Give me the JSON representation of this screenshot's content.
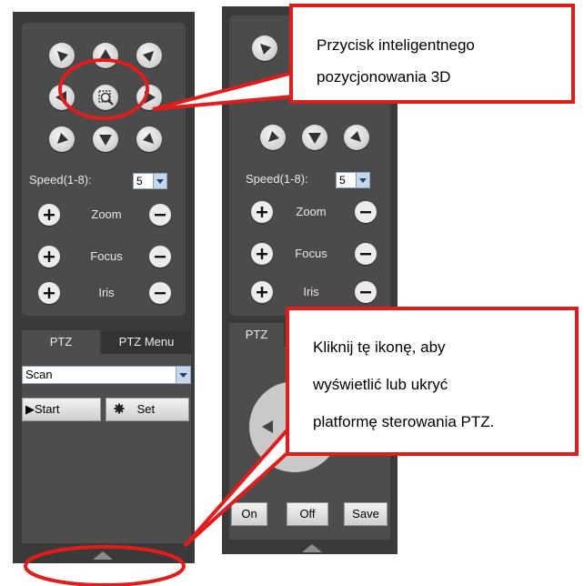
{
  "left_panel": {
    "speed_label": "Speed(1-8):",
    "speed_value": "5",
    "zoom_label": "Zoom",
    "focus_label": "Focus",
    "iris_label": "Iris",
    "tab_ptz": "PTZ",
    "tab_ptz_menu": "PTZ Menu",
    "mode_value": "Scan",
    "start_label": "▶Start",
    "set_label": "Set"
  },
  "right_panel": {
    "speed_label": "Speed(1-8):",
    "speed_value": "5",
    "zoom_label": "Zoom",
    "focus_label": "Focus",
    "iris_label": "Iris",
    "tab_ptz_partial": "PTZ",
    "on_label": "On",
    "off_label": "Off",
    "save_label": "Save"
  },
  "callouts": {
    "top_line1": "Przycisk inteligentnego",
    "top_line2": "pozycjonowania 3D",
    "bottom_line1": "Kliknij tę ikonę, aby",
    "bottom_line2": "wyświetlić lub ukryć",
    "bottom_line3": "platformę sterowania PTZ."
  },
  "colors": {
    "panel_bg": "#3a3a3a",
    "annotation_red": "#e31b1b"
  }
}
